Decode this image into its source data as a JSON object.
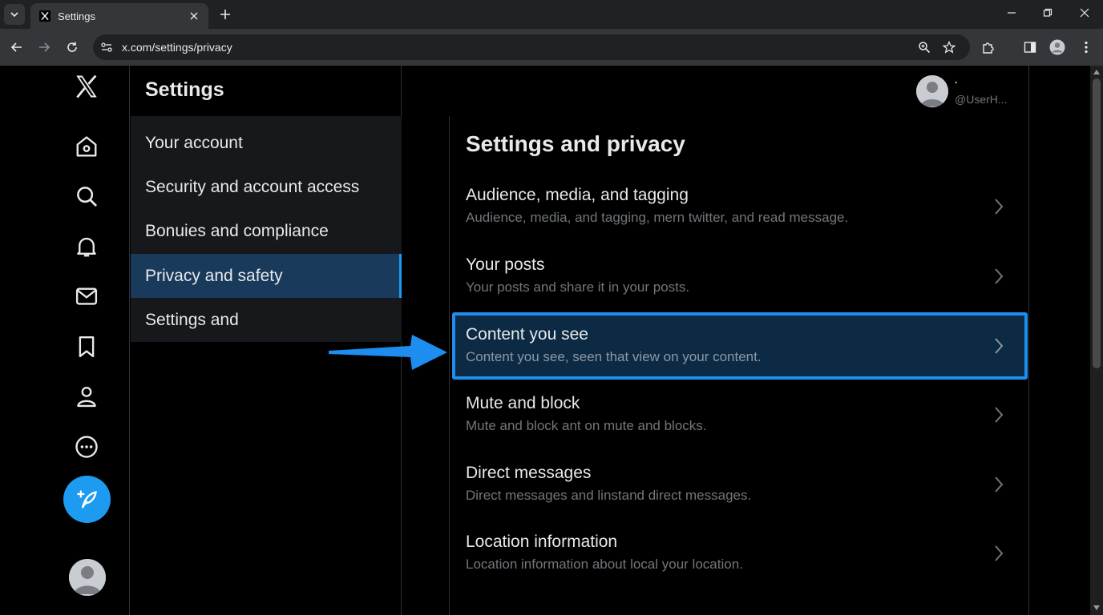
{
  "browser": {
    "tab_title": "Settings",
    "url": "x.com/settings/privacy"
  },
  "settings_column": {
    "title": "Settings",
    "items": [
      {
        "label": "Your account"
      },
      {
        "label": "Security and account access"
      },
      {
        "label": "Bonuies and compliance"
      },
      {
        "label": "Privacy and safety",
        "active": true
      },
      {
        "label": "Settings and"
      }
    ]
  },
  "profile": {
    "name": "·",
    "handle": "@UserH..."
  },
  "detail": {
    "title": "Settings and privacy",
    "rows": [
      {
        "title": "Audience, media, and tagging",
        "subtitle": "Audience, media, and tagging, mern twitter, and read message."
      },
      {
        "title": "Your posts",
        "subtitle": "Your posts and share it in your posts."
      },
      {
        "title": "Content you see",
        "subtitle": "Content you see, seen that view on your content.",
        "highlighted": true
      },
      {
        "title": "Mute and block",
        "subtitle": "Mute and block ant on mute and blocks."
      },
      {
        "title": "Direct messages",
        "subtitle": "Direct messages and linstand direct messages."
      },
      {
        "title": "Location information",
        "subtitle": "Location information about local your location."
      }
    ]
  },
  "colors": {
    "accent": "#1d9bf0",
    "highlight_border": "#1d8ef0",
    "active_menu_bg": "#1a3a5c"
  }
}
